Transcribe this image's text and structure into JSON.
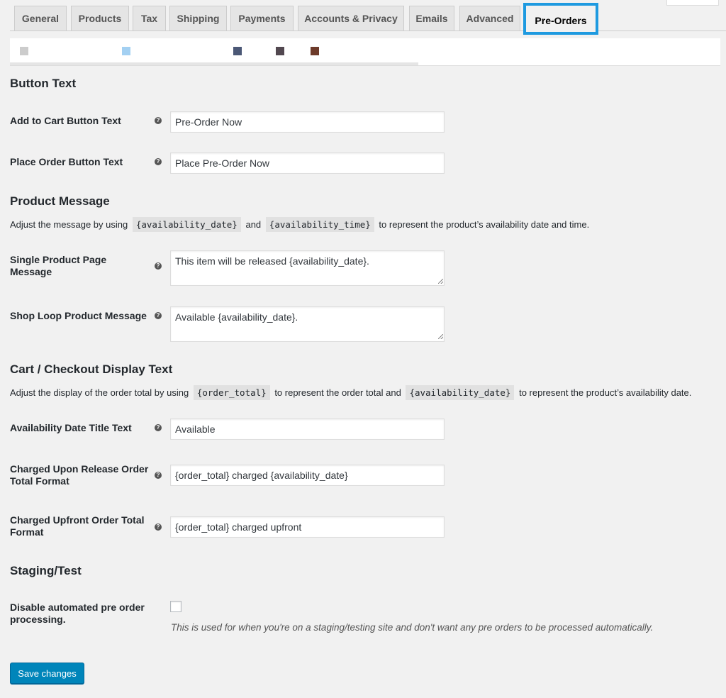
{
  "tabs": [
    {
      "label": "General"
    },
    {
      "label": "Products"
    },
    {
      "label": "Tax"
    },
    {
      "label": "Shipping"
    },
    {
      "label": "Payments"
    },
    {
      "label": "Accounts & Privacy"
    },
    {
      "label": "Emails"
    },
    {
      "label": "Advanced"
    },
    {
      "label": "Pre-Orders",
      "active": true
    }
  ],
  "colors": {
    "accent_highlight": "#1e9ae0",
    "button_primary": "#0085ba",
    "swatches": [
      "#cccccc",
      "#a3d0f2",
      "#4b5876",
      "#524850",
      "#6d3b2a"
    ]
  },
  "button_text": {
    "heading": "Button Text",
    "add_to_cart_label": "Add to Cart Button Text",
    "add_to_cart_value": "Pre-Order Now",
    "place_order_label": "Place Order Button Text",
    "place_order_value": "Place Pre-Order Now"
  },
  "product_message": {
    "heading": "Product Message",
    "desc_prefix": "Adjust the message by using",
    "code1": "{availability_date}",
    "desc_and": "and",
    "code2": "{availability_time}",
    "desc_suffix": "to represent the product’s availability date and time.",
    "single_label": "Single Product Page Message",
    "single_value": "This item will be released {availability_date}.",
    "loop_label": "Shop Loop Product Message",
    "loop_value": "Available {availability_date}."
  },
  "cart_checkout": {
    "heading": "Cart / Checkout Display Text",
    "desc_prefix": "Adjust the display of the order total by using",
    "code1": "{order_total}",
    "desc_mid": "to represent the order total and",
    "code2": "{availability_date}",
    "desc_suffix": "to represent the product’s availability date.",
    "availability_label": "Availability Date Title Text",
    "availability_value": "Available",
    "charged_release_label": "Charged Upon Release Order Total Format",
    "charged_release_value": "{order_total} charged {availability_date}",
    "charged_upfront_label": "Charged Upfront Order Total Format",
    "charged_upfront_value": "{order_total} charged upfront"
  },
  "staging": {
    "heading": "Staging/Test",
    "disable_label": "Disable automated pre order processing.",
    "disable_checked": false,
    "note": "This is used for when you're on a staging/testing site and don't want any pre orders to be processed automatically."
  },
  "save_label": "Save changes"
}
